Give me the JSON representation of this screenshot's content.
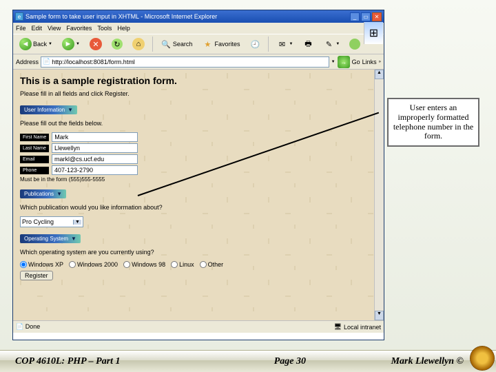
{
  "window": {
    "title": "Sample form to take user input in XHTML - Microsoft Internet Explorer",
    "menu": [
      "File",
      "Edit",
      "View",
      "Favorites",
      "Tools",
      "Help"
    ]
  },
  "toolbar": {
    "back": "Back",
    "search": "Search",
    "favorites": "Favorites"
  },
  "address": {
    "label": "Address",
    "url": "http://localhost:8081/form.html",
    "go": "Go",
    "links": "Links"
  },
  "page": {
    "heading": "This is a sample registration form.",
    "instruction": "Please fill in all fields and click Register.",
    "section1": "User Information",
    "fill": "Please fill out the fields below.",
    "fields": {
      "first": {
        "label": "First Name",
        "value": "Mark"
      },
      "last": {
        "label": "Last Name",
        "value": "Llewellyn"
      },
      "email": {
        "label": "Email",
        "value": "markl@cs.ucf.edu"
      },
      "phone": {
        "label": "Phone",
        "value": "407-123-2790"
      }
    },
    "phone_hint": "Must be in the form (555)555-5555",
    "section2": "Publications",
    "pub_q": "Which publication would you like information about?",
    "pub_value": "Pro Cycling",
    "section3": "Operating System",
    "os_q": "Which operating system are you currently using?",
    "os": [
      "Windows XP",
      "Windows 2000",
      "Windows 98",
      "Linux",
      "Other"
    ],
    "register": "Register"
  },
  "status": {
    "left": "Done",
    "right": "Local intranet"
  },
  "callout": "User enters an improperly formatted telephone number in the form.",
  "footer": {
    "left": "COP 4610L: PHP – Part 1",
    "mid": "Page 30",
    "right": "Mark Llewellyn ©"
  }
}
